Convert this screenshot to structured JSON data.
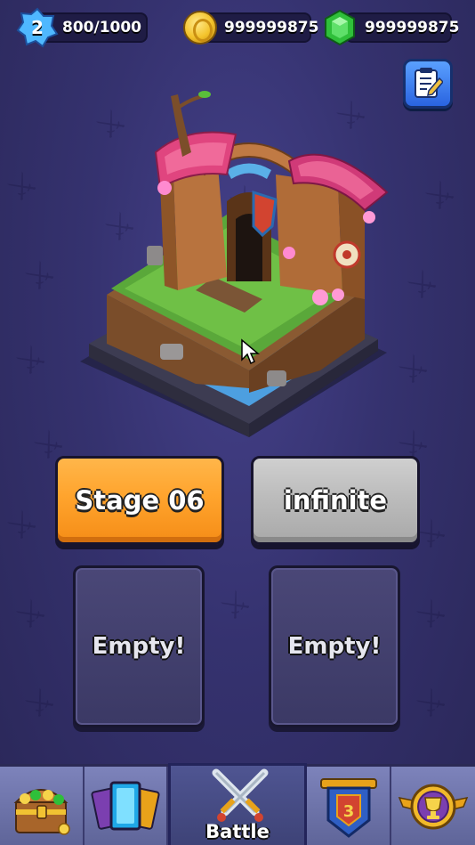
{
  "player": {
    "level": "2",
    "xp_text": "800/1000",
    "gold": "999999875",
    "gems": "999999875"
  },
  "icons": {
    "level": "xp-star-icon",
    "gold": "gold-coin-icon",
    "gems": "green-gem-icon",
    "notes": "notepad-icon",
    "shop": "treasure-chest-icon",
    "cards": "cards-icon",
    "battle": "crossed-swords-icon",
    "clan": "clan-shield-icon",
    "trophy": "trophy-icon"
  },
  "modes": {
    "stage_label": "Stage 06",
    "infinite_label": "infinite"
  },
  "slots": [
    {
      "label": "Empty!"
    },
    {
      "label": "Empty!"
    }
  ],
  "nav": {
    "battle_label": "Battle"
  },
  "colors": {
    "stage_button": "#ffa42d",
    "infinite_button": "#bcbcbc",
    "background": "#3a3673",
    "nav_bar": "#7d83bb"
  }
}
